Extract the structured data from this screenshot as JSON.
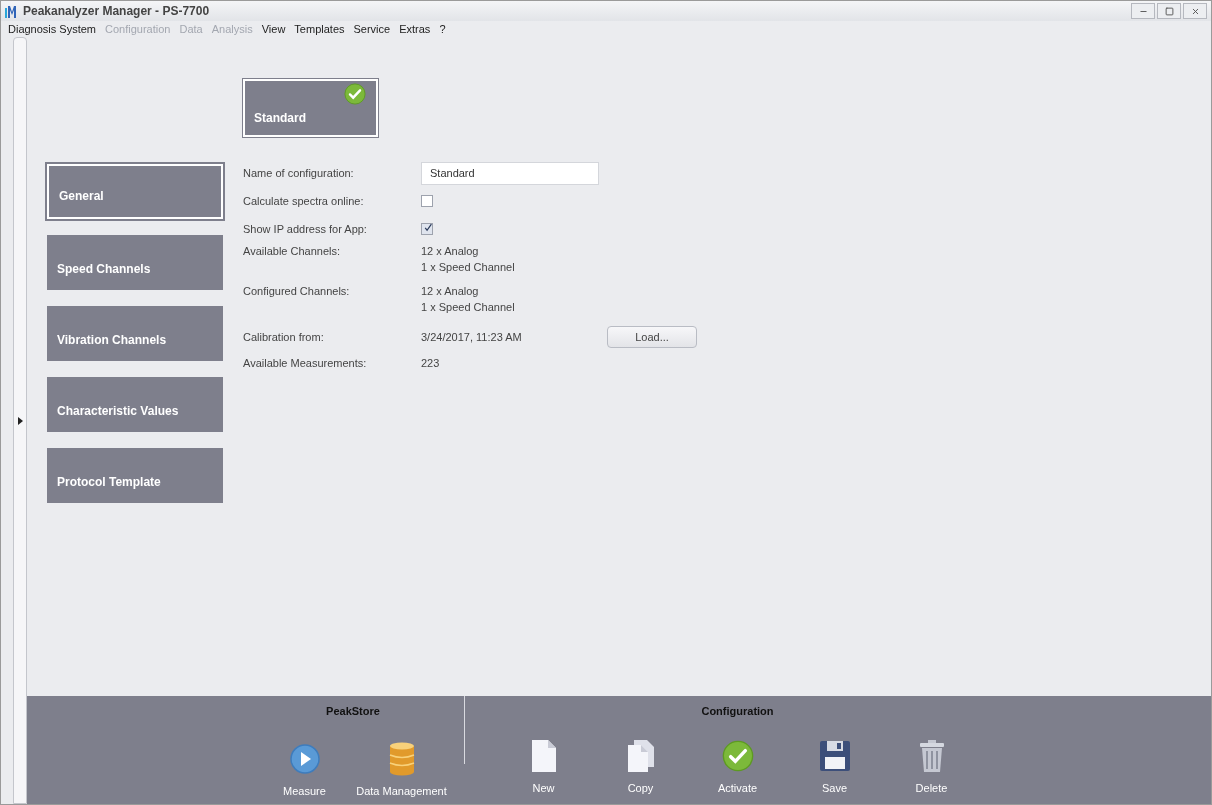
{
  "window": {
    "title": "Peakanalyzer Manager - PS-7700"
  },
  "menu": [
    {
      "label": "Diagnosis System",
      "disabled": false
    },
    {
      "label": "Configuration",
      "disabled": true
    },
    {
      "label": "Data",
      "disabled": true
    },
    {
      "label": "Analysis",
      "disabled": true
    },
    {
      "label": "View",
      "disabled": false
    },
    {
      "label": "Templates",
      "disabled": false
    },
    {
      "label": "Service",
      "disabled": false
    },
    {
      "label": "Extras",
      "disabled": false
    },
    {
      "label": "?",
      "disabled": false
    }
  ],
  "configuration_tile": {
    "label": "Standard",
    "active": true
  },
  "sections": [
    {
      "label": "General",
      "selected": true
    },
    {
      "label": "Speed Channels",
      "selected": false
    },
    {
      "label": "Vibration Channels",
      "selected": false
    },
    {
      "label": "Characteristic Values",
      "selected": false
    },
    {
      "label": "Protocol Template",
      "selected": false
    }
  ],
  "form": [
    {
      "kind": "input",
      "label": "Name of configuration:",
      "value": "Standard"
    },
    {
      "kind": "checkbox",
      "label": "Calculate spectra online:",
      "checked": false
    },
    {
      "kind": "checkbox",
      "label": "Show IP address for App:",
      "checked": true
    },
    {
      "kind": "lines",
      "label": "Available Channels:",
      "lines": [
        "12 x Analog",
        "1 x Speed Channel"
      ]
    },
    {
      "kind": "lines",
      "label": "Configured Channels:",
      "lines": [
        "12 x Analog",
        "1 x Speed Channel"
      ]
    },
    {
      "kind": "button",
      "label": "Calibration from:",
      "value": "3/24/2017, 11:23 AM",
      "button": "Load..."
    },
    {
      "kind": "text",
      "label": "Available Measurements:",
      "value": "223"
    }
  ],
  "toolbar": {
    "groups": [
      {
        "title": "PeakStore",
        "buttons": [
          {
            "kind": "play",
            "label": "Measure"
          },
          {
            "kind": "database",
            "label": "Data Management"
          }
        ]
      },
      {
        "title": "Configuration",
        "buttons": [
          {
            "kind": "new",
            "label": "New"
          },
          {
            "kind": "copy",
            "label": "Copy"
          },
          {
            "kind": "check",
            "label": "Activate"
          },
          {
            "kind": "save",
            "label": "Save"
          },
          {
            "kind": "delete",
            "label": "Delete"
          }
        ]
      }
    ]
  }
}
